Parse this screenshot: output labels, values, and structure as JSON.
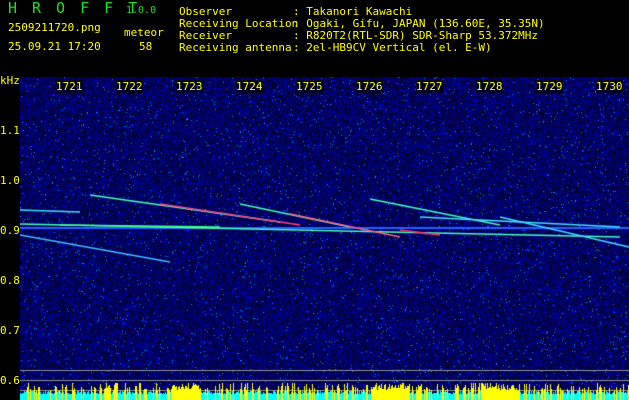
{
  "app": {
    "logo": "HROFFT",
    "version": "1.0.0"
  },
  "file": {
    "name": "2509211720.png",
    "datetime": "25.09.21 17:20"
  },
  "meteor": {
    "label": "meteor",
    "count": "58"
  },
  "info": [
    {
      "label": "Observer",
      "value": ": Takanori Kawachi"
    },
    {
      "label": "Receiving Location",
      "value": ": Ogaki, Gifu, JAPAN (136.60E, 35.35N)"
    },
    {
      "label": "Receiver",
      "value": ": R820T2(RTL-SDR) SDR-Sharp 53.372MHz"
    },
    {
      "label": "Receiving antenna",
      "value": ": 2el-HB9CV Vertical (el. E-W)"
    }
  ],
  "axis": {
    "y_unit": "kHz",
    "y_ticks": [
      "1.1",
      "1.0",
      "0.9",
      "0.8",
      "0.7",
      "0.6"
    ],
    "x_ticks": [
      "1721",
      "1722",
      "1723",
      "1724",
      "1725",
      "1726",
      "1727",
      "1728",
      "1729",
      "1730"
    ]
  },
  "colors": {
    "label": "#ffff00",
    "logo": "#22dd22",
    "spectrum_bg": "#000a60",
    "bar_yellow": "#ffff00",
    "bar_cyan": "#00ffff"
  }
}
